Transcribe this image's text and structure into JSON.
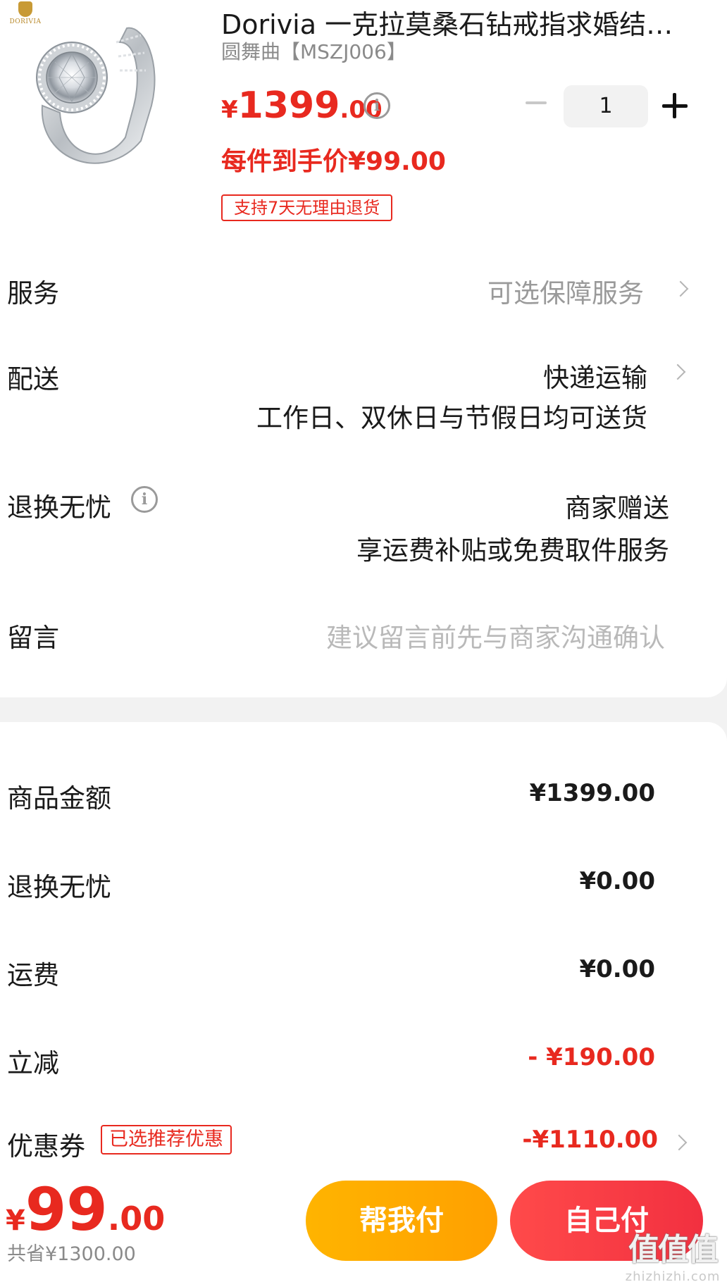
{
  "product": {
    "brand_logo_text": "DORIVIA",
    "title": "Dorivia 一克拉莫桑石钻戒指求婚结…",
    "sku": "圆舞曲【MSZJ006】",
    "price_currency": "¥",
    "price_int": "1399",
    "price_dec": ".00",
    "info_glyph": "i",
    "quantity": "1",
    "unit_price_label": "每件到手价¥99.00",
    "return_badge": "支持7天无理由退货"
  },
  "rows": {
    "service_label": "服务",
    "service_value": "可选保障服务",
    "delivery_label": "配送",
    "delivery_value": "快递运输",
    "delivery_note": "工作日、双休日与节假日均可送货",
    "returns_label": "退换无忧",
    "returns_value": "商家赠送",
    "returns_note": "享运费补贴或免费取件服务",
    "message_label": "留言",
    "message_placeholder": "建议留言前先与商家沟通确认"
  },
  "summary": {
    "goods_label": "商品金额",
    "goods_value": "¥1399.00",
    "returns_label": "退换无忧",
    "returns_value": "¥0.00",
    "shipping_label": "运费",
    "shipping_value": "¥0.00",
    "discount_label": "立减",
    "discount_value": "- ¥190.00",
    "coupon_label": "优惠券",
    "coupon_badge": "已选推荐优惠",
    "coupon_value": "-¥1110.00"
  },
  "bottom_bar": {
    "total_currency": "¥",
    "total_int": "99",
    "total_dec": ".00",
    "saved": "共省¥1300.00",
    "help_pay": "帮我付",
    "self_pay": "自己付"
  },
  "watermark": {
    "text": "值值值",
    "site": "zhizhizhi.com"
  },
  "colors": {
    "accent_red": "#e8291f",
    "help_button": "#ffa800",
    "self_button": "#f5383f"
  }
}
